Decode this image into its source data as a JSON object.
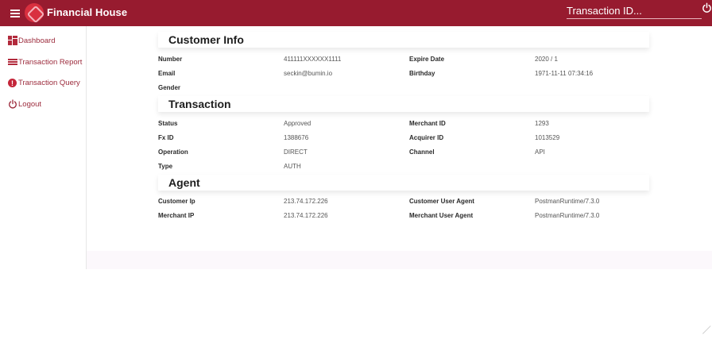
{
  "header": {
    "brand": "Financial House",
    "search_placeholder": "Transaction ID...",
    "menu_icon": "menu-icon",
    "logo_icon": "logo-icon",
    "power_icon": "power-icon"
  },
  "sidebar": {
    "items": [
      {
        "label": "Dashboard",
        "icon": "dashboard-icon"
      },
      {
        "label": "Transaction Report",
        "icon": "list-icon"
      },
      {
        "label": "Transaction Query",
        "icon": "alert-icon"
      },
      {
        "label": "Logout",
        "icon": "power-icon"
      }
    ]
  },
  "customer_info": {
    "title": "Customer Info",
    "number_label": "Number",
    "number": "411111XXXXXX1111",
    "expire_label": "Expire Date",
    "expire": "2020 / 1",
    "email_label": "Email",
    "email": "seckin@bumin.io",
    "birthday_label": "Birthday",
    "birthday": "1971-11-11 07:34:16",
    "gender_label": "Gender"
  },
  "transaction": {
    "title": "Transaction",
    "status_label": "Status",
    "status": "Approved",
    "merchant_id_label": "Merchant ID",
    "merchant_id": "1293",
    "fx_id_label": "Fx ID",
    "fx_id": "1388676",
    "acquirer_id_label": "Acquirer ID",
    "acquirer_id": "1013529",
    "operation_label": "Operation",
    "operation": "DIRECT",
    "channel_label": "Channel",
    "channel": "API",
    "type_label": "Type",
    "type": "AUTH"
  },
  "agent": {
    "title": "Agent",
    "customer_ip_label": "Customer Ip",
    "customer_ip": "213.74.172.226",
    "customer_ua_label": "Customer User Agent",
    "customer_ua": "PostmanRuntime/7.3.0",
    "merchant_ip_label": "Merchant IP",
    "merchant_ip": "213.74.172.226",
    "merchant_ua_label": "Merchant User Agent",
    "merchant_ua": "PostmanRuntime/7.3.0"
  },
  "colors": {
    "primary": "#971b2f",
    "accent": "#c4263a"
  }
}
